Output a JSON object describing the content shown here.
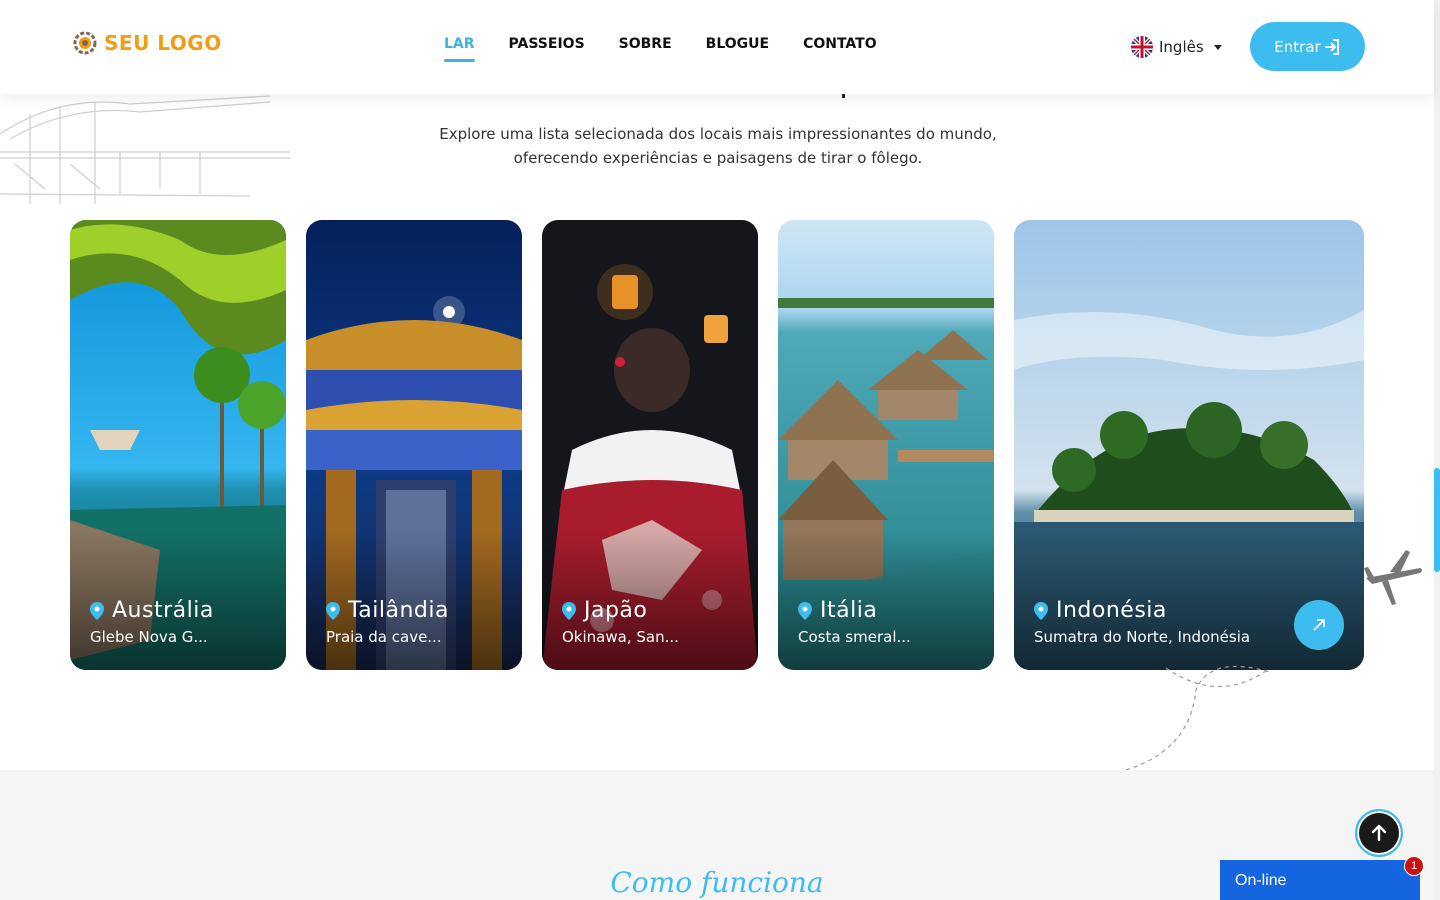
{
  "header": {
    "logo_text": "SEU LOGO",
    "nav": [
      "LAR",
      "PASSEIOS",
      "SOBRE",
      "BLOGUE",
      "CONTATO"
    ],
    "language": "Inglês",
    "login_label": "Entrar"
  },
  "section": {
    "intro_line1": "Explore uma lista selecionada dos locais mais impressionantes do mundo,",
    "intro_line2": "oferecendo experiências e paisagens de tirar o fôlego."
  },
  "cards": [
    {
      "name": "Austrália",
      "location": "Glebe Nova G..."
    },
    {
      "name": "Tailândia",
      "location": "Praia da cave..."
    },
    {
      "name": "Japão",
      "location": "Okinawa, San..."
    },
    {
      "name": "Itália",
      "location": "Costa smeral..."
    },
    {
      "name": "Indonésia",
      "location": "Sumatra do Norte, Indonésia"
    }
  ],
  "lower": {
    "script_title": "Como funciona"
  },
  "chat": {
    "label": "On-line",
    "badge": "1"
  },
  "colors": {
    "accent": "#3dbcf0",
    "logo": "#f39c12",
    "chat": "#1565e0"
  }
}
